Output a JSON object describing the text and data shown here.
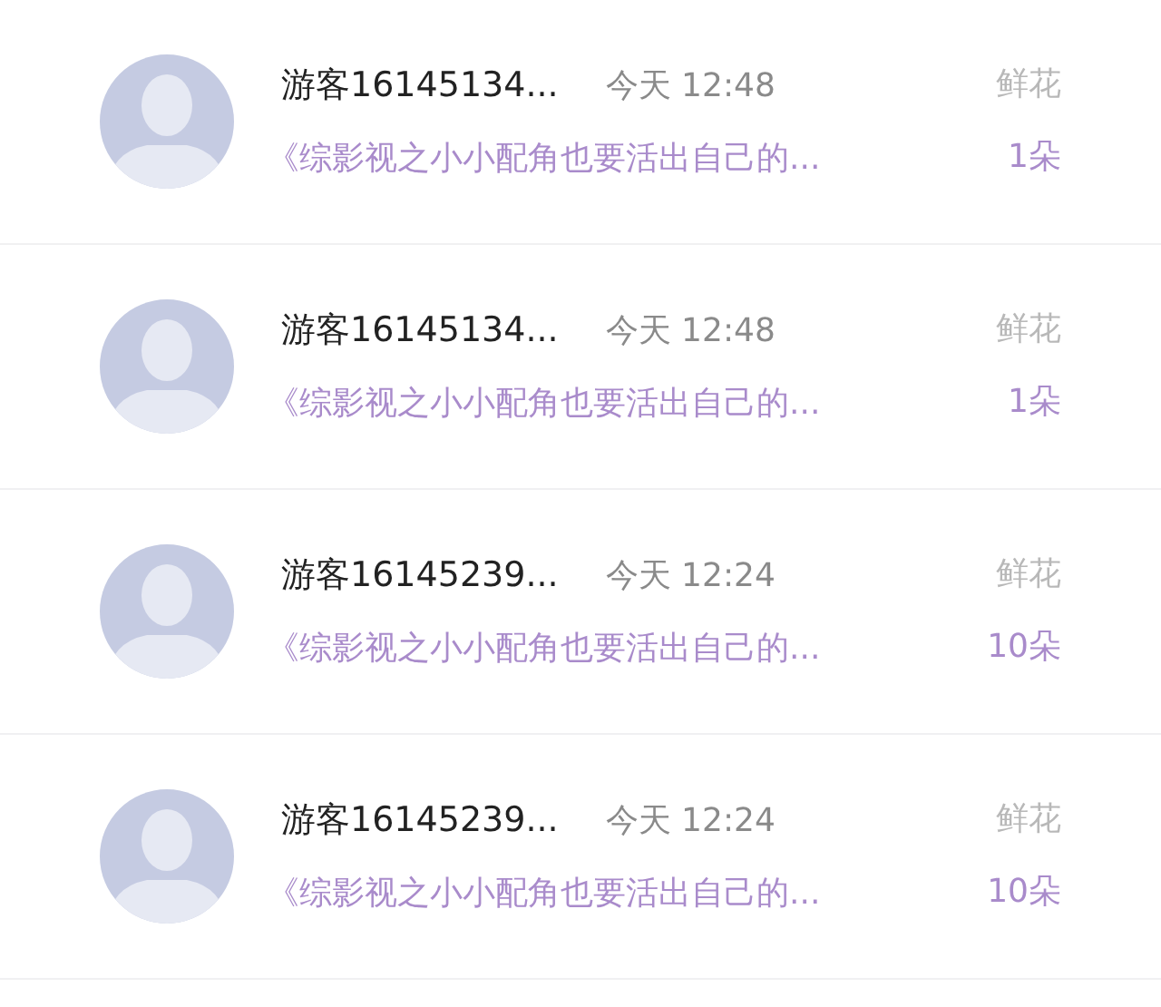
{
  "gifts": [
    {
      "user": "游客16145134...",
      "time": "今天 12:48",
      "gift": "鲜花",
      "book": "《综影视之小小配角也要活出自己的...",
      "count": "1朵"
    },
    {
      "user": "游客16145134...",
      "time": "今天 12:48",
      "gift": "鲜花",
      "book": "《综影视之小小配角也要活出自己的...",
      "count": "1朵"
    },
    {
      "user": "游客16145239...",
      "time": "今天 12:24",
      "gift": "鲜花",
      "book": "《综影视之小小配角也要活出自己的...",
      "count": "10朵"
    },
    {
      "user": "游客16145239...",
      "time": "今天 12:24",
      "gift": "鲜花",
      "book": "《综影视之小小配角也要活出自己的...",
      "count": "10朵"
    }
  ]
}
